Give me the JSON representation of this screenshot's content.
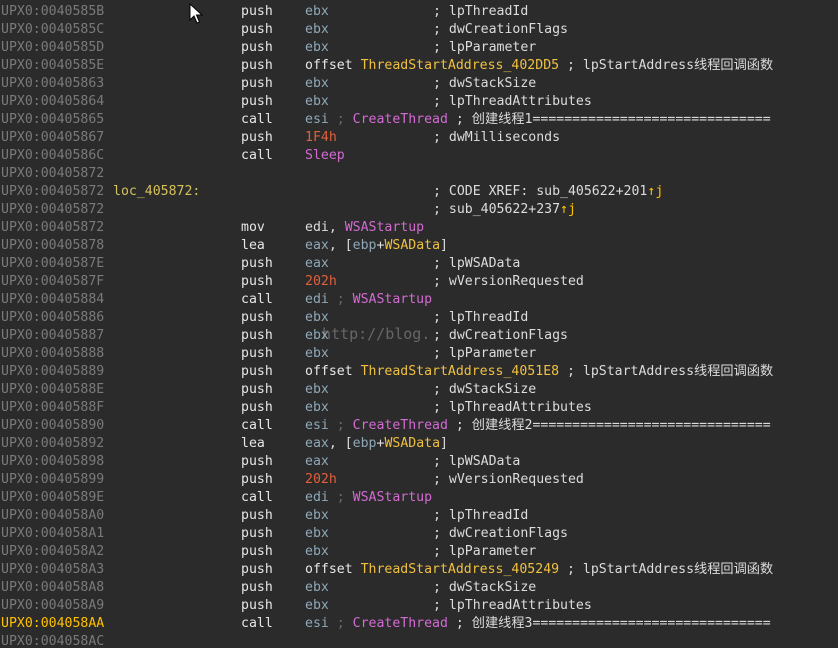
{
  "colors": {
    "background": "#2b2b2b",
    "address": "#7a7a7a",
    "address_current": "#ffc100",
    "label": "#d6c25a",
    "register": "#8fa8b8",
    "number": "#e0603c",
    "function": "#d36bd3",
    "symbol": "#f0c040"
  },
  "watermark": "http://blog.",
  "lines": [
    {
      "addr": "UPX0:0040585B",
      "mnem": "push",
      "opnd": [
        [
          "reg",
          "ebx"
        ]
      ],
      "cmt": "; lpThreadId"
    },
    {
      "addr": "UPX0:0040585C",
      "mnem": "push",
      "opnd": [
        [
          "reg",
          "ebx"
        ]
      ],
      "cmt": "; dwCreationFlags"
    },
    {
      "addr": "UPX0:0040585D",
      "mnem": "push",
      "opnd": [
        [
          "reg",
          "ebx"
        ]
      ],
      "cmt": "; lpParameter"
    },
    {
      "addr": "UPX0:0040585E",
      "mnem": "push",
      "opnd": [
        [
          "off",
          "offset "
        ],
        [
          "sym",
          "ThreadStartAddress_402DD5"
        ],
        [
          "plain",
          " ; lpStartAddress线程回调函数"
        ]
      ],
      "cmt": ""
    },
    {
      "addr": "UPX0:00405863",
      "mnem": "push",
      "opnd": [
        [
          "reg",
          "ebx"
        ]
      ],
      "cmt": "; dwStackSize"
    },
    {
      "addr": "UPX0:00405864",
      "mnem": "push",
      "opnd": [
        [
          "reg",
          "ebx"
        ]
      ],
      "cmt": "; lpThreadAttributes"
    },
    {
      "addr": "UPX0:00405865",
      "mnem": "call",
      "opnd": [
        [
          "reg",
          "esi"
        ],
        [
          "sep",
          " ; "
        ],
        [
          "func",
          "CreateThread"
        ],
        [
          "plain",
          " ; 创建线程1=============================="
        ]
      ],
      "cmt": ""
    },
    {
      "addr": "UPX0:00405867",
      "mnem": "push",
      "opnd": [
        [
          "num",
          "1F4h"
        ]
      ],
      "cmt": "; dwMilliseconds"
    },
    {
      "addr": "UPX0:0040586C",
      "mnem": "call",
      "opnd": [
        [
          "func",
          "Sleep"
        ]
      ],
      "cmt": ""
    },
    {
      "addr": "UPX0:00405872",
      "mnem": "",
      "opnd": [],
      "cmt": ""
    },
    {
      "addr": "UPX0:00405872",
      "label": "loc_405872:",
      "mnem": "",
      "opnd": [],
      "cmt": "; CODE XREF: sub_405622+201",
      "xref": true
    },
    {
      "addr": "UPX0:00405872",
      "mnem": "",
      "opnd": [],
      "cmt": "; sub_405622+237",
      "xref": true
    },
    {
      "addr": "UPX0:00405872",
      "mnem": "mov",
      "opnd": [
        [
          "plain",
          "edi, "
        ],
        [
          "func",
          "WSAStartup"
        ]
      ],
      "cmt": ""
    },
    {
      "addr": "UPX0:00405878",
      "mnem": "lea",
      "opnd": [
        [
          "reg",
          "eax"
        ],
        [
          "plain",
          ", ["
        ],
        [
          "reg",
          "ebp"
        ],
        [
          "plain",
          "+"
        ],
        [
          "sym",
          "WSAData"
        ],
        [
          "plain",
          "]"
        ]
      ],
      "cmt": ""
    },
    {
      "addr": "UPX0:0040587E",
      "mnem": "push",
      "opnd": [
        [
          "reg",
          "eax"
        ]
      ],
      "cmt": "; lpWSAData"
    },
    {
      "addr": "UPX0:0040587F",
      "mnem": "push",
      "opnd": [
        [
          "num",
          "202h"
        ]
      ],
      "cmt": "; wVersionRequested"
    },
    {
      "addr": "UPX0:00405884",
      "mnem": "call",
      "opnd": [
        [
          "reg",
          "edi"
        ],
        [
          "sep",
          " ; "
        ],
        [
          "func",
          "WSAStartup"
        ]
      ],
      "cmt": ""
    },
    {
      "addr": "UPX0:00405886",
      "mnem": "push",
      "opnd": [
        [
          "reg",
          "ebx"
        ]
      ],
      "cmt": "; lpThreadId"
    },
    {
      "addr": "UPX0:00405887",
      "mnem": "push",
      "opnd": [
        [
          "reg",
          "ebx"
        ]
      ],
      "cmt": "; dwCreationFlags"
    },
    {
      "addr": "UPX0:00405888",
      "mnem": "push",
      "opnd": [
        [
          "reg",
          "ebx"
        ]
      ],
      "cmt": "; lpParameter"
    },
    {
      "addr": "UPX0:00405889",
      "mnem": "push",
      "opnd": [
        [
          "off",
          "offset "
        ],
        [
          "sym",
          "ThreadStartAddress_4051E8"
        ],
        [
          "plain",
          " ; lpStartAddress线程回调函数"
        ]
      ],
      "cmt": ""
    },
    {
      "addr": "UPX0:0040588E",
      "mnem": "push",
      "opnd": [
        [
          "reg",
          "ebx"
        ]
      ],
      "cmt": "; dwStackSize"
    },
    {
      "addr": "UPX0:0040588F",
      "mnem": "push",
      "opnd": [
        [
          "reg",
          "ebx"
        ]
      ],
      "cmt": "; lpThreadAttributes"
    },
    {
      "addr": "UPX0:00405890",
      "mnem": "call",
      "opnd": [
        [
          "reg",
          "esi"
        ],
        [
          "sep",
          " ; "
        ],
        [
          "func",
          "CreateThread"
        ],
        [
          "plain",
          " ; 创建线程2=============================="
        ]
      ],
      "cmt": ""
    },
    {
      "addr": "UPX0:00405892",
      "mnem": "lea",
      "opnd": [
        [
          "reg",
          "eax"
        ],
        [
          "plain",
          ", ["
        ],
        [
          "reg",
          "ebp"
        ],
        [
          "plain",
          "+"
        ],
        [
          "sym",
          "WSAData"
        ],
        [
          "plain",
          "]"
        ]
      ],
      "cmt": ""
    },
    {
      "addr": "UPX0:00405898",
      "mnem": "push",
      "opnd": [
        [
          "reg",
          "eax"
        ]
      ],
      "cmt": "; lpWSAData"
    },
    {
      "addr": "UPX0:00405899",
      "mnem": "push",
      "opnd": [
        [
          "num",
          "202h"
        ]
      ],
      "cmt": "; wVersionRequested"
    },
    {
      "addr": "UPX0:0040589E",
      "mnem": "call",
      "opnd": [
        [
          "reg",
          "edi"
        ],
        [
          "sep",
          " ; "
        ],
        [
          "func",
          "WSAStartup"
        ]
      ],
      "cmt": ""
    },
    {
      "addr": "UPX0:004058A0",
      "mnem": "push",
      "opnd": [
        [
          "reg",
          "ebx"
        ]
      ],
      "cmt": "; lpThreadId"
    },
    {
      "addr": "UPX0:004058A1",
      "mnem": "push",
      "opnd": [
        [
          "reg",
          "ebx"
        ]
      ],
      "cmt": "; dwCreationFlags"
    },
    {
      "addr": "UPX0:004058A2",
      "mnem": "push",
      "opnd": [
        [
          "reg",
          "ebx"
        ]
      ],
      "cmt": "; lpParameter"
    },
    {
      "addr": "UPX0:004058A3",
      "mnem": "push",
      "opnd": [
        [
          "off",
          "offset "
        ],
        [
          "sym",
          "ThreadStartAddress_405249"
        ],
        [
          "plain",
          " ; lpStartAddress线程回调函数"
        ]
      ],
      "cmt": ""
    },
    {
      "addr": "UPX0:004058A8",
      "mnem": "push",
      "opnd": [
        [
          "reg",
          "ebx"
        ]
      ],
      "cmt": "; dwStackSize"
    },
    {
      "addr": "UPX0:004058A9",
      "mnem": "push",
      "opnd": [
        [
          "reg",
          "ebx"
        ]
      ],
      "cmt": "; lpThreadAttributes"
    },
    {
      "addr": "UPX0:004058AA",
      "mnem": "call",
      "opnd": [
        [
          "reg",
          "esi"
        ],
        [
          "sep",
          " ; "
        ],
        [
          "func",
          "CreateThread"
        ],
        [
          "plain",
          " ; 创建线程3=============================="
        ]
      ],
      "cmt": "",
      "current": true
    },
    {
      "addr": "UPX0:004058AC",
      "mnem": "",
      "opnd": [],
      "cmt": ""
    }
  ]
}
